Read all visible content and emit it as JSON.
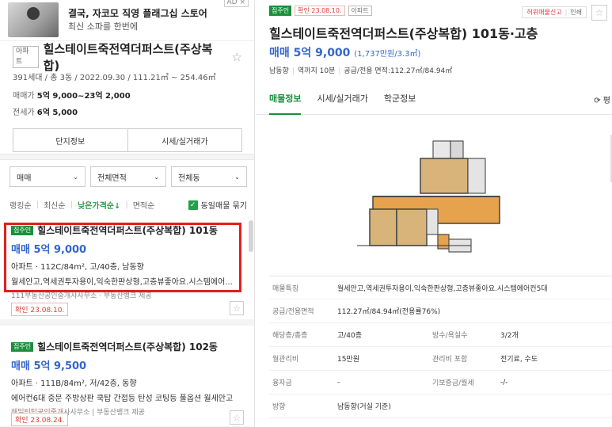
{
  "ad": {
    "title": "결국, 자코모 직영 플래그십 스토어",
    "subtitle": "최신 소파를 한번에",
    "badge": "AD ×"
  },
  "complex": {
    "type_tag": "아파트",
    "name": "힐스테이트죽전역더퍼스트(주상복합)",
    "star": "☆",
    "meta": "391세대 / 총 3동 / 2022.09.30 / 111.21㎡ ~ 254.46㎡",
    "sale_label": "매매가",
    "sale_value": "5억 9,000~23억 2,000",
    "jeonse_label": "전세가",
    "jeonse_value": "6억 5,000",
    "btn_info": "단지정보",
    "btn_price": "시세/실거래가"
  },
  "filters": {
    "trade": "매매",
    "area": "전체면적",
    "dong": "전체동",
    "chevron": "⌄"
  },
  "sort": {
    "ranking": "랭킹순",
    "latest": "최신순",
    "low_price": "낮은가격순↓",
    "area": "면적순",
    "same_listing": "동일매물 묶기",
    "check": "✓"
  },
  "listings": [
    {
      "tag": "집주인",
      "name": "힐스테이트죽전역더퍼스트(주상복합) 101동",
      "price": "매매 5억 9,000",
      "info": "아파트 · 112C/84m², 고/40층, 남동향",
      "desc": "월세안고,역세권투자용이,익숙한판상형,고층뷰좋아요.시스템에어...",
      "agency": "111부동산공인중개사사무소 · 부동산뱅크 제공",
      "confirm": "확인 23.08.10.",
      "fav": "☆"
    },
    {
      "tag": "집주인",
      "name": "힐스테이트죽전역더퍼스트(주상복합) 102동",
      "price": "매매 5억 9,500",
      "info": "아파트 · 111B/84m², 저/42층, 동향",
      "desc": "에어컨6대 중문 주방상판 쿡탑 간접등 탄성 코팅등 풀옵션 월세안고",
      "agency": "해밀턴탑공인중개사사무소 | 부동산뱅크 제공",
      "confirm": "확인 23.08.24.",
      "fav": "☆"
    }
  ],
  "detail": {
    "tag_owner": "집주인",
    "tag_confirm": "확인 23.08.10.",
    "tag_type": "아파트",
    "report": "허위매물신고",
    "print": "인쇄",
    "fav": "☆",
    "title": "힐스테이트죽전역더퍼스트(주상복합) 101동·고층",
    "price": "매매 5억 9,000",
    "price_per": "(1,737만원/3.3㎡)",
    "meta": [
      "남동향",
      "역까지 10분",
      "공급/전용 면적:112.27㎡/84.94㎡"
    ],
    "tabs": [
      "매물정보",
      "시세/실거래가",
      "학군정보"
    ],
    "reset": "⟳ 평",
    "specs": [
      {
        "k": "매물특징",
        "v": "월세안고,역세권투자용이,익숙한판상형,고층뷰좋아요.시스템에어컨5대"
      },
      {
        "k": "공급/전용면적",
        "v": "112.27㎡/84.94㎡(전용률76%)"
      },
      {
        "k": "해당층/총층",
        "v": "고/40층",
        "k2": "방수/욕실수",
        "v2": "3/2개"
      },
      {
        "k": "월관리비",
        "v": "15만원",
        "k2": "관리비 포함",
        "v2": "전기료, 수도"
      },
      {
        "k": "융자금",
        "v": "-",
        "k2": "기보증금/월세",
        "v2": "-/-"
      },
      {
        "k": "방향",
        "v": "남동향(거실 기준)"
      }
    ]
  },
  "colors": {
    "accent_green": "#1a8f3c",
    "price_blue": "#3366cc",
    "highlight_red": "#e0201d"
  }
}
